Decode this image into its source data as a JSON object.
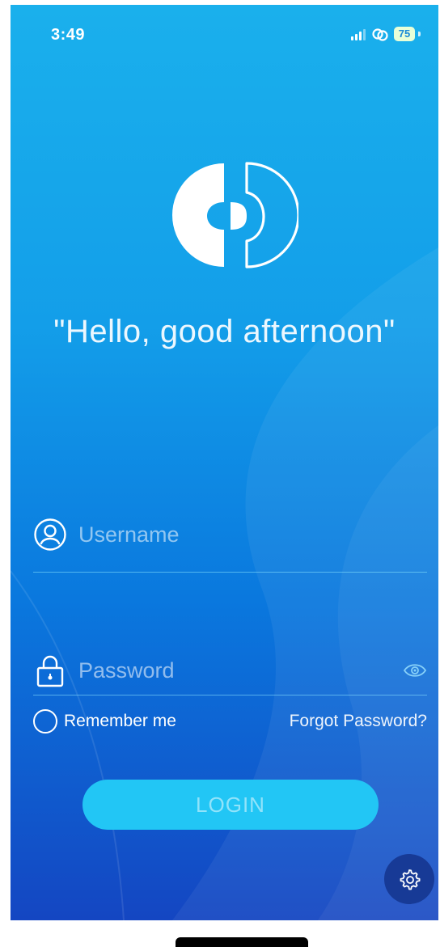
{
  "status_bar": {
    "time": "3:49",
    "battery": "75",
    "icons": [
      "signal-icon",
      "link-icon",
      "battery-icon"
    ]
  },
  "logo": {
    "icon": "app-logo"
  },
  "greeting": "\"Hello, good afternoon\"",
  "login_form": {
    "username": {
      "placeholder": "Username",
      "value": "",
      "icon": "user-circle-icon"
    },
    "password": {
      "placeholder": "Password",
      "value": "",
      "icon": "lock-icon",
      "toggle_icon": "eye-icon"
    },
    "remember_me": {
      "label": "Remember me",
      "checked": false
    },
    "forgot_password": "Forgot Password?",
    "login_button": "LOGIN"
  },
  "settings": {
    "icon": "gear-icon"
  },
  "colors": {
    "background_top": "#1ab0ec",
    "background_bottom": "#1446c2",
    "button": "#22c6f5",
    "settings_button": "#173a96"
  }
}
